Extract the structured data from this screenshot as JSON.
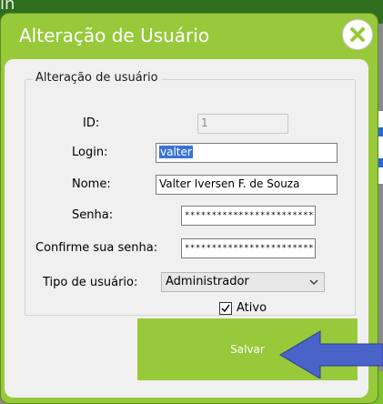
{
  "background": {
    "top_fragment": "in"
  },
  "dialog": {
    "title": "Alteração de Usuário",
    "close_icon": "close-icon",
    "group_label": "Alteração de usuário",
    "fields": {
      "id": {
        "label": "ID:",
        "value": "1"
      },
      "login": {
        "label": "Login:",
        "value": "valter"
      },
      "nome": {
        "label": "Nome:",
        "value": "Valter Iversen F. de Souza"
      },
      "senha": {
        "label": "Senha:",
        "value": "******************************"
      },
      "confirme": {
        "label": "Confirme sua senha:",
        "value": "******************************"
      },
      "tipo": {
        "label": "Tipo de usuário:",
        "value": "Administrador"
      }
    },
    "ativo": {
      "label": "Ativo",
      "checked": true
    },
    "save_label": "Salvar"
  },
  "colors": {
    "accent_green": "#97c93b",
    "annotation_arrow": "#4a63c8"
  }
}
